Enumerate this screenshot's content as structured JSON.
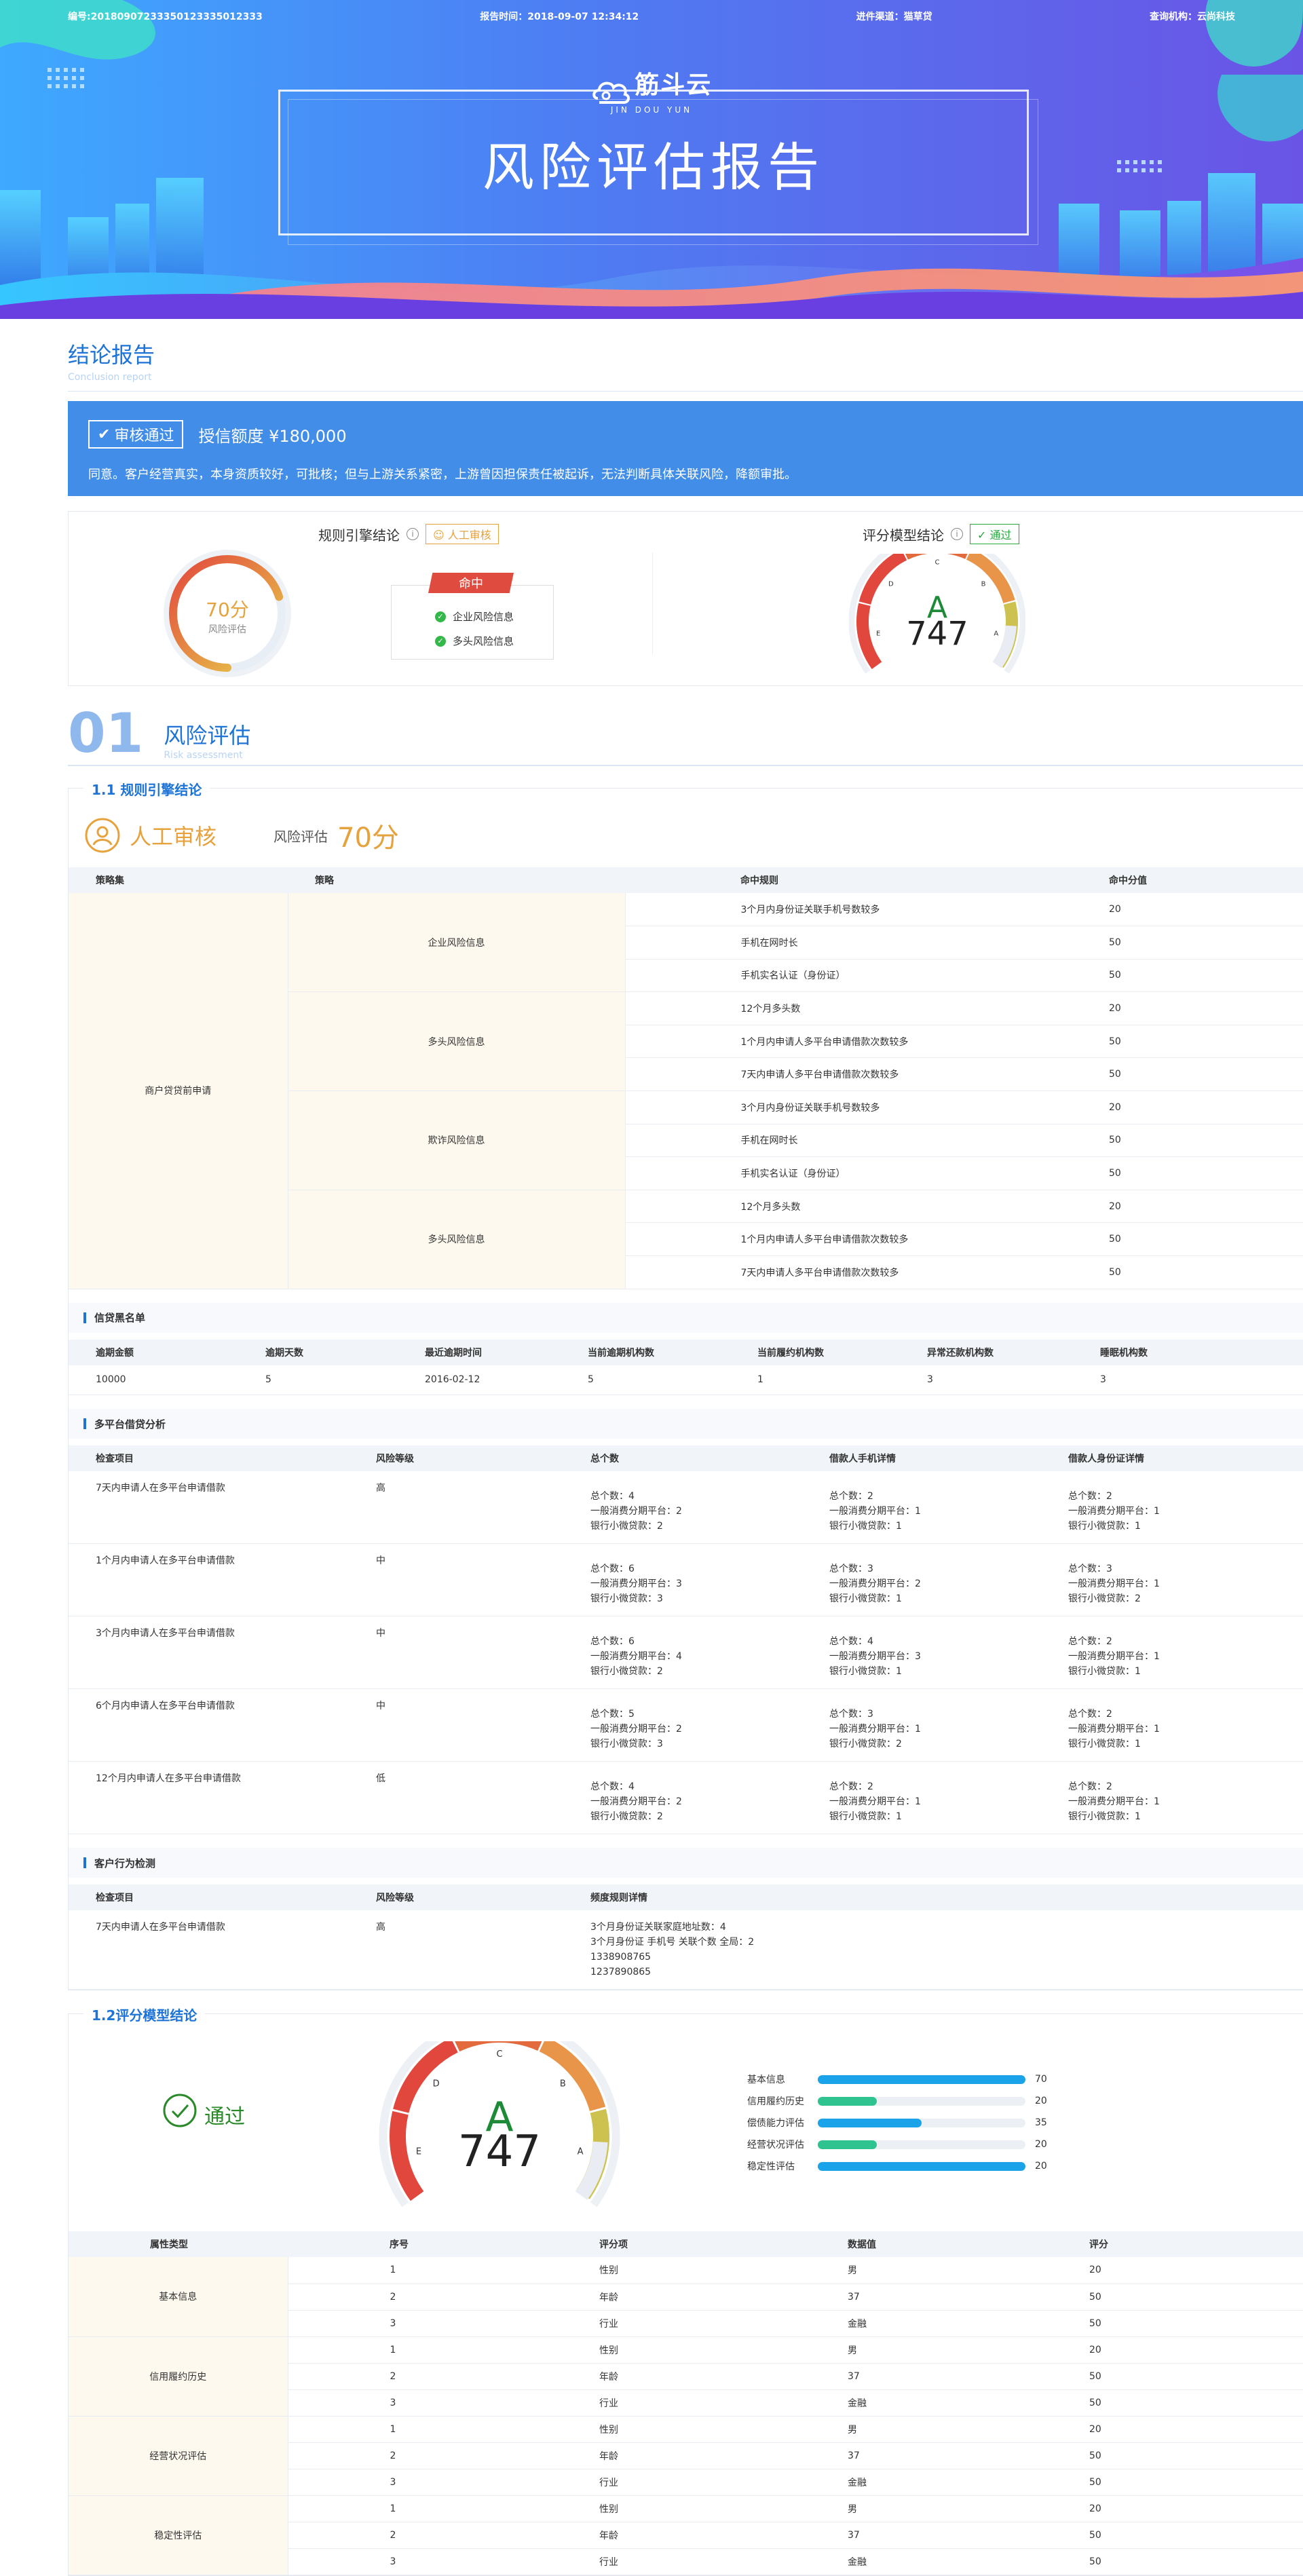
{
  "header": {
    "serial": "编号:20180907233350123335012333",
    "report_time": "报告时间：2018-09-07 12:34:12",
    "channel": "进件渠道：猫草贷",
    "org": "查询机构：云尚科技"
  },
  "brand": {
    "name": "筋斗云",
    "sub": "JIN DOU YUN"
  },
  "title": "风险评估报告",
  "conclusion": {
    "heading": "结论报告",
    "heading_en": "Conclusion report",
    "status": "审核通过",
    "quota": "授信额度 ¥180,000",
    "desc": "同意。客户经营真实，本身资质较好，可批核；但与上游关系紧密，上游曾因担保责任被起诉，无法判断具体关联风险，降额审批。"
  },
  "rule_panel": {
    "title": "规则引擎结论",
    "tag": "人工审核",
    "score_text": "70分",
    "score_value": 70,
    "score_label": "风险评估",
    "hit_label": "命中",
    "hits": [
      "企业风险信息",
      "多头风险信息"
    ]
  },
  "model_panel": {
    "title": "评分模型结论",
    "tag": "通过",
    "grade": "A",
    "score": "747",
    "grades": [
      "E",
      "D",
      "C",
      "B",
      "A"
    ]
  },
  "section1": {
    "num": "01",
    "title": "风险评估",
    "title_en": "Risk assessment"
  },
  "rules": {
    "box_title": "1.1 规则引擎结论",
    "manual": "人工审核",
    "risk_label": "风险评估",
    "risk_score": "70分",
    "headers": [
      "策略集",
      "策略",
      "命中规则",
      "命中分值"
    ],
    "policy_set": "商户贷贷前申请",
    "groups": [
      {
        "name": "企业风险信息",
        "rows": [
          [
            "3个月内身份证关联手机号数较多",
            "20"
          ],
          [
            "手机在网时长",
            "50"
          ],
          [
            "手机实名认证（身份证）",
            "50"
          ]
        ]
      },
      {
        "name": "多头风险信息",
        "rows": [
          [
            "12个月多头数",
            "20"
          ],
          [
            "1个月内申请人多平台申请借款次数较多",
            "50"
          ],
          [
            "7天内申请人多平台申请借款次数较多",
            "50"
          ]
        ]
      },
      {
        "name": "欺诈风险信息",
        "rows": [
          [
            "3个月内身份证关联手机号数较多",
            "20"
          ],
          [
            "手机在网时长",
            "50"
          ],
          [
            "手机实名认证（身份证）",
            "50"
          ]
        ]
      },
      {
        "name": "多头风险信息",
        "rows": [
          [
            "12个月多头数",
            "20"
          ],
          [
            "1个月内申请人多平台申请借款次数较多",
            "50"
          ],
          [
            "7天内申请人多平台申请借款次数较多",
            "50"
          ]
        ]
      }
    ]
  },
  "blacklist": {
    "title": "信贷黑名单",
    "headers": [
      "逾期金额",
      "逾期天数",
      "最近逾期时间",
      "当前逾期机构数",
      "当前履约机构数",
      "异常还款机构数",
      "睡眠机构数"
    ],
    "row": [
      "10000",
      "5",
      "2016-02-12",
      "5",
      "1",
      "3",
      "3"
    ]
  },
  "multi": {
    "title": "多平台借贷分析",
    "headers": [
      "检查项目",
      "风险等级",
      "总个数",
      "借款人手机详情",
      "借款人身份证详情"
    ],
    "rows": [
      {
        "item": "7天内申请人在多平台申请借款",
        "level": "高",
        "total": [
          "总个数：4",
          "一般消费分期平台：2",
          "银行小微贷款：2"
        ],
        "phone": [
          "总个数：2",
          "一般消费分期平台：1",
          "银行小微贷款：1"
        ],
        "id": [
          "总个数：2",
          "一般消费分期平台：1",
          "银行小微贷款：1"
        ]
      },
      {
        "item": "1个月内申请人在多平台申请借款",
        "level": "中",
        "total": [
          "总个数：6",
          "一般消费分期平台：3",
          "银行小微贷款：3"
        ],
        "phone": [
          "总个数：3",
          "一般消费分期平台：2",
          "银行小微贷款：1"
        ],
        "id": [
          "总个数：3",
          "一般消费分期平台：1",
          "银行小微贷款：2"
        ]
      },
      {
        "item": "3个月内申请人在多平台申请借款",
        "level": "中",
        "total": [
          "总个数：6",
          "一般消费分期平台：4",
          "银行小微贷款：2"
        ],
        "phone": [
          "总个数：4",
          "一般消费分期平台：3",
          "银行小微贷款：1"
        ],
        "id": [
          "总个数：2",
          "一般消费分期平台：1",
          "银行小微贷款：1"
        ]
      },
      {
        "item": "6个月内申请人在多平台申请借款",
        "level": "中",
        "total": [
          "总个数：5",
          "一般消费分期平台：2",
          "银行小微贷款：3"
        ],
        "phone": [
          "总个数：3",
          "一般消费分期平台：1",
          "银行小微贷款：2"
        ],
        "id": [
          "总个数：2",
          "一般消费分期平台：1",
          "银行小微贷款：1"
        ]
      },
      {
        "item": "12个月内申请人在多平台申请借款",
        "level": "低",
        "total": [
          "总个数：4",
          "一般消费分期平台：2",
          "银行小微贷款：2"
        ],
        "phone": [
          "总个数：2",
          "一般消费分期平台：1",
          "银行小微贷款：1"
        ],
        "id": [
          "总个数：2",
          "一般消费分期平台：1",
          "银行小微贷款：1"
        ]
      }
    ]
  },
  "behavior": {
    "title": "客户行为检测",
    "headers": [
      "检查项目",
      "风险等级",
      "频度规则详情"
    ],
    "row": {
      "item": "7天内申请人在多平台申请借款",
      "level": "高",
      "details": [
        "3个月身份证关联家庭地址数：4",
        "3个月身份证 手机号 关联个数 全局：2",
        "1338908765",
        "1237890865"
      ]
    }
  },
  "model": {
    "box_title": "1.2评分模型结论",
    "status": "通过",
    "grade": "A",
    "score": "747",
    "grades": [
      "E",
      "D",
      "C",
      "B",
      "A"
    ],
    "bars": [
      {
        "label": "基本信息",
        "value": 70,
        "text": "70",
        "color": "#1aa3e8"
      },
      {
        "label": "信用履约历史",
        "value": 20,
        "text": "20",
        "color": "#2ec38f"
      },
      {
        "label": "偿债能力评估",
        "value": 35,
        "text": "35",
        "color": "#1aa3e8"
      },
      {
        "label": "经营状况评估",
        "value": 20,
        "text": "20",
        "color": "#2ec38f"
      },
      {
        "label": "稳定性评估",
        "value": 70,
        "text": "20",
        "color": "#1aa3e8"
      }
    ],
    "headers": [
      "属性类型",
      "序号",
      "评分项",
      "数据值",
      "评分"
    ],
    "groups": [
      {
        "name": "基本信息",
        "rows": [
          [
            "1",
            "性别",
            "男",
            "20"
          ],
          [
            "2",
            "年龄",
            "37",
            "50"
          ],
          [
            "3",
            "行业",
            "金融",
            "50"
          ]
        ]
      },
      {
        "name": "信用履约历史",
        "rows": [
          [
            "1",
            "性别",
            "男",
            "20"
          ],
          [
            "2",
            "年龄",
            "37",
            "50"
          ],
          [
            "3",
            "行业",
            "金融",
            "50"
          ]
        ]
      },
      {
        "name": "经营状况评估",
        "rows": [
          [
            "1",
            "性别",
            "男",
            "20"
          ],
          [
            "2",
            "年龄",
            "37",
            "50"
          ],
          [
            "3",
            "行业",
            "金融",
            "50"
          ]
        ]
      },
      {
        "name": "稳定性评估",
        "rows": [
          [
            "1",
            "性别",
            "男",
            "20"
          ],
          [
            "2",
            "年龄",
            "37",
            "50"
          ],
          [
            "3",
            "行业",
            "金融",
            "50"
          ]
        ]
      }
    ]
  }
}
